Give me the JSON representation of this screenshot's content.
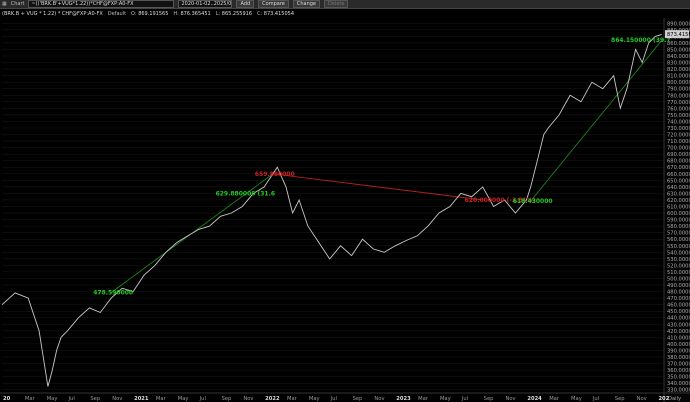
{
  "toolbar": {
    "chart_label": "Chart",
    "symbol_value": "~(('BRK.B'+VUG*1.22))*CHF@FXP:A0-FX",
    "date_range": "2020-01-02..2025/0",
    "add_label": "Add",
    "compare_label": "Compare",
    "change_label": "Change",
    "delete_label": "Delete"
  },
  "symbol_row": {
    "name": "(BRK.B + VUG * 1.22) * CHF@FXP:A0-FX",
    "default_label": "Default",
    "o_label": "O:",
    "o_value": "869.191565",
    "h_label": "H:",
    "h_value": "876.365451",
    "l_label": "L:",
    "l_value": "865.255916",
    "c_label": "C:",
    "c_value": "873.415054"
  },
  "colors": {
    "background": "#000000",
    "price_line": "#c8c8c8",
    "trend_line": "#1f8f1f",
    "annotation_green": "#22cc22",
    "annotation_red": "#cc2222",
    "grid": "#1a1a1a",
    "last_price_bg": "#cfcfcf"
  },
  "chart_data": {
    "type": "line",
    "period_label": "Daily",
    "last_price_label": "873.415054",
    "ylim": [
      325,
      895
    ],
    "y_ticks": [
      "890.000000",
      "880.000000",
      "870.000000",
      "860.000000",
      "850.000000",
      "840.000000",
      "830.000000",
      "820.000000",
      "810.000000",
      "800.000000",
      "790.000000",
      "780.000000",
      "770.000000",
      "760.000000",
      "750.000000",
      "740.000000",
      "730.000000",
      "720.000000",
      "710.000000",
      "700.000000",
      "690.000000",
      "680.000000",
      "670.000000",
      "660.000000",
      "650.000000",
      "640.000000",
      "630.000000",
      "620.000000",
      "610.000000",
      "600.000000",
      "590.000000",
      "580.000000",
      "570.000000",
      "560.000000",
      "550.000000",
      "540.000000",
      "530.000000",
      "520.000000",
      "510.000000",
      "500.000000",
      "490.000000",
      "480.000000",
      "470.000000",
      "460.000000",
      "450.000000",
      "440.000000",
      "430.000000",
      "420.000000",
      "410.000000",
      "400.000000",
      "390.000000",
      "380.000000",
      "370.000000",
      "360.000000",
      "350.000000",
      "340.000000",
      "330.000000"
    ],
    "x_ticks": [
      "20",
      "Mar",
      "May",
      "Jul",
      "Sep",
      "Nov",
      "2021",
      "Mar",
      "May",
      "Jul",
      "Sep",
      "Nov",
      "2022",
      "Mar",
      "May",
      "Jul",
      "Sep",
      "Nov",
      "2023",
      "Mar",
      "May",
      "Jul",
      "Sep",
      "Nov",
      "2024",
      "Mar",
      "May",
      "Jul",
      "Sep",
      "Nov",
      "202"
    ],
    "series": [
      {
        "x": [
          0,
          0.6,
          1.2,
          1.7,
          2.1,
          2.3,
          2.5,
          2.7,
          3,
          3.5,
          4,
          4.5,
          5,
          5.5,
          6,
          6.5,
          7,
          7.5,
          8,
          8.5,
          9,
          9.5,
          10,
          10.5,
          11,
          11.5,
          12,
          12.3,
          12.6,
          13,
          13.3,
          13.6,
          14,
          14.5,
          15,
          15.5,
          16,
          16.5,
          17,
          17.5,
          18,
          18.5,
          19,
          19.5,
          20,
          20.5,
          21,
          21.5,
          22,
          22.5,
          23,
          23.5,
          24,
          24.2,
          24.5,
          24.8,
          25,
          25.5,
          26,
          26.5,
          27,
          27.5,
          28,
          28.3,
          28.6,
          29,
          29.3,
          29.6,
          29.9,
          30.2
        ],
        "y": [
          460,
          478,
          470,
          420,
          335,
          360,
          390,
          410,
          420,
          440,
          455,
          448,
          470,
          485,
          480,
          505,
          520,
          540,
          555,
          565,
          575,
          580,
          595,
          600,
          610,
          630,
          640,
          655,
          670,
          640,
          600,
          620,
          580,
          555,
          530,
          550,
          535,
          560,
          545,
          540,
          550,
          558,
          565,
          580,
          600,
          610,
          630,
          625,
          640,
          610,
          620,
          600,
          620,
          640,
          680,
          720,
          730,
          750,
          780,
          770,
          800,
          790,
          810,
          760,
          790,
          850,
          830,
          860,
          870,
          873
        ]
      }
    ],
    "annotations": [
      {
        "label": "478.590000",
        "color": "green",
        "x": 5.0,
        "y": 478.59
      },
      {
        "label": "629.880000 (31.6",
        "color": "green",
        "x": 10.6,
        "y": 629.88
      },
      {
        "label": "659.880000",
        "color": "red",
        "x": 12.4,
        "y": 659.88
      },
      {
        "label": "620.000000 (-3.81%)",
        "color": "red",
        "x": 22.0,
        "y": 620.0
      },
      {
        "label": "618.430000",
        "color": "green",
        "x": 24.2,
        "y": 618.43
      },
      {
        "label": "864.150000 (39.7",
        "color": "green",
        "x": 28.7,
        "y": 864.15
      }
    ],
    "trend_lines": [
      {
        "color": "green",
        "x": [
          5.0,
          12.4
        ],
        "y": [
          478.59,
          659.88
        ]
      },
      {
        "color": "red",
        "x": [
          12.4,
          22.0
        ],
        "y": [
          659.88,
          620.0
        ]
      },
      {
        "color": "green",
        "x": [
          24.2,
          30.2
        ],
        "y": [
          618.43,
          864.15
        ]
      }
    ]
  }
}
